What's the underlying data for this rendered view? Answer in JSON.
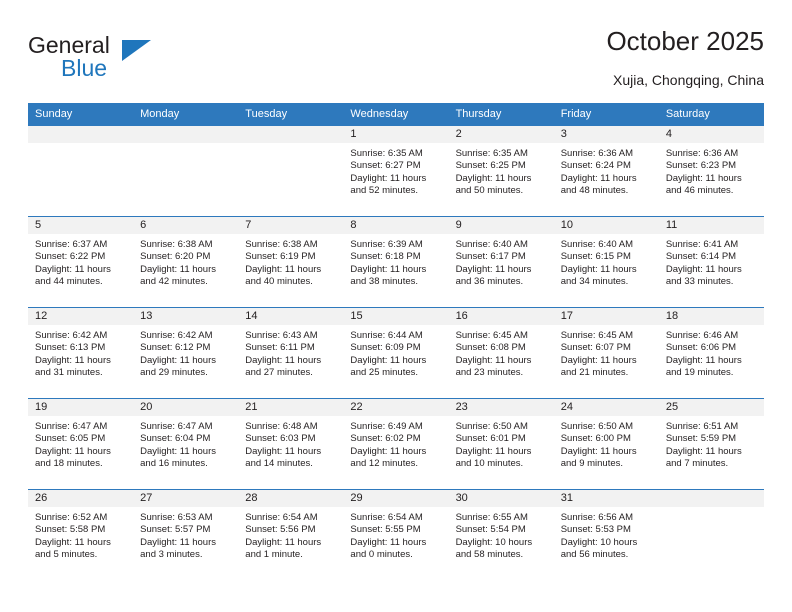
{
  "logo": {
    "word_top": "General",
    "word_bottom": "Blue",
    "accent_color": "#1f76bc"
  },
  "header": {
    "title": "October 2025",
    "location": "Xujia, Chongqing, China",
    "header_bg": "#2e79bd",
    "daynum_bg": "#f2f2f2"
  },
  "weekdays": [
    "Sunday",
    "Monday",
    "Tuesday",
    "Wednesday",
    "Thursday",
    "Friday",
    "Saturday"
  ],
  "weeks": [
    [
      {
        "day": "",
        "sunrise": "",
        "sunset": "",
        "daylight1": "",
        "daylight2": ""
      },
      {
        "day": "",
        "sunrise": "",
        "sunset": "",
        "daylight1": "",
        "daylight2": ""
      },
      {
        "day": "",
        "sunrise": "",
        "sunset": "",
        "daylight1": "",
        "daylight2": ""
      },
      {
        "day": "1",
        "sunrise": "Sunrise: 6:35 AM",
        "sunset": "Sunset: 6:27 PM",
        "daylight1": "Daylight: 11 hours",
        "daylight2": "and 52 minutes."
      },
      {
        "day": "2",
        "sunrise": "Sunrise: 6:35 AM",
        "sunset": "Sunset: 6:25 PM",
        "daylight1": "Daylight: 11 hours",
        "daylight2": "and 50 minutes."
      },
      {
        "day": "3",
        "sunrise": "Sunrise: 6:36 AM",
        "sunset": "Sunset: 6:24 PM",
        "daylight1": "Daylight: 11 hours",
        "daylight2": "and 48 minutes."
      },
      {
        "day": "4",
        "sunrise": "Sunrise: 6:36 AM",
        "sunset": "Sunset: 6:23 PM",
        "daylight1": "Daylight: 11 hours",
        "daylight2": "and 46 minutes."
      }
    ],
    [
      {
        "day": "5",
        "sunrise": "Sunrise: 6:37 AM",
        "sunset": "Sunset: 6:22 PM",
        "daylight1": "Daylight: 11 hours",
        "daylight2": "and 44 minutes."
      },
      {
        "day": "6",
        "sunrise": "Sunrise: 6:38 AM",
        "sunset": "Sunset: 6:20 PM",
        "daylight1": "Daylight: 11 hours",
        "daylight2": "and 42 minutes."
      },
      {
        "day": "7",
        "sunrise": "Sunrise: 6:38 AM",
        "sunset": "Sunset: 6:19 PM",
        "daylight1": "Daylight: 11 hours",
        "daylight2": "and 40 minutes."
      },
      {
        "day": "8",
        "sunrise": "Sunrise: 6:39 AM",
        "sunset": "Sunset: 6:18 PM",
        "daylight1": "Daylight: 11 hours",
        "daylight2": "and 38 minutes."
      },
      {
        "day": "9",
        "sunrise": "Sunrise: 6:40 AM",
        "sunset": "Sunset: 6:17 PM",
        "daylight1": "Daylight: 11 hours",
        "daylight2": "and 36 minutes."
      },
      {
        "day": "10",
        "sunrise": "Sunrise: 6:40 AM",
        "sunset": "Sunset: 6:15 PM",
        "daylight1": "Daylight: 11 hours",
        "daylight2": "and 34 minutes."
      },
      {
        "day": "11",
        "sunrise": "Sunrise: 6:41 AM",
        "sunset": "Sunset: 6:14 PM",
        "daylight1": "Daylight: 11 hours",
        "daylight2": "and 33 minutes."
      }
    ],
    [
      {
        "day": "12",
        "sunrise": "Sunrise: 6:42 AM",
        "sunset": "Sunset: 6:13 PM",
        "daylight1": "Daylight: 11 hours",
        "daylight2": "and 31 minutes."
      },
      {
        "day": "13",
        "sunrise": "Sunrise: 6:42 AM",
        "sunset": "Sunset: 6:12 PM",
        "daylight1": "Daylight: 11 hours",
        "daylight2": "and 29 minutes."
      },
      {
        "day": "14",
        "sunrise": "Sunrise: 6:43 AM",
        "sunset": "Sunset: 6:11 PM",
        "daylight1": "Daylight: 11 hours",
        "daylight2": "and 27 minutes."
      },
      {
        "day": "15",
        "sunrise": "Sunrise: 6:44 AM",
        "sunset": "Sunset: 6:09 PM",
        "daylight1": "Daylight: 11 hours",
        "daylight2": "and 25 minutes."
      },
      {
        "day": "16",
        "sunrise": "Sunrise: 6:45 AM",
        "sunset": "Sunset: 6:08 PM",
        "daylight1": "Daylight: 11 hours",
        "daylight2": "and 23 minutes."
      },
      {
        "day": "17",
        "sunrise": "Sunrise: 6:45 AM",
        "sunset": "Sunset: 6:07 PM",
        "daylight1": "Daylight: 11 hours",
        "daylight2": "and 21 minutes."
      },
      {
        "day": "18",
        "sunrise": "Sunrise: 6:46 AM",
        "sunset": "Sunset: 6:06 PM",
        "daylight1": "Daylight: 11 hours",
        "daylight2": "and 19 minutes."
      }
    ],
    [
      {
        "day": "19",
        "sunrise": "Sunrise: 6:47 AM",
        "sunset": "Sunset: 6:05 PM",
        "daylight1": "Daylight: 11 hours",
        "daylight2": "and 18 minutes."
      },
      {
        "day": "20",
        "sunrise": "Sunrise: 6:47 AM",
        "sunset": "Sunset: 6:04 PM",
        "daylight1": "Daylight: 11 hours",
        "daylight2": "and 16 minutes."
      },
      {
        "day": "21",
        "sunrise": "Sunrise: 6:48 AM",
        "sunset": "Sunset: 6:03 PM",
        "daylight1": "Daylight: 11 hours",
        "daylight2": "and 14 minutes."
      },
      {
        "day": "22",
        "sunrise": "Sunrise: 6:49 AM",
        "sunset": "Sunset: 6:02 PM",
        "daylight1": "Daylight: 11 hours",
        "daylight2": "and 12 minutes."
      },
      {
        "day": "23",
        "sunrise": "Sunrise: 6:50 AM",
        "sunset": "Sunset: 6:01 PM",
        "daylight1": "Daylight: 11 hours",
        "daylight2": "and 10 minutes."
      },
      {
        "day": "24",
        "sunrise": "Sunrise: 6:50 AM",
        "sunset": "Sunset: 6:00 PM",
        "daylight1": "Daylight: 11 hours",
        "daylight2": "and 9 minutes."
      },
      {
        "day": "25",
        "sunrise": "Sunrise: 6:51 AM",
        "sunset": "Sunset: 5:59 PM",
        "daylight1": "Daylight: 11 hours",
        "daylight2": "and 7 minutes."
      }
    ],
    [
      {
        "day": "26",
        "sunrise": "Sunrise: 6:52 AM",
        "sunset": "Sunset: 5:58 PM",
        "daylight1": "Daylight: 11 hours",
        "daylight2": "and 5 minutes."
      },
      {
        "day": "27",
        "sunrise": "Sunrise: 6:53 AM",
        "sunset": "Sunset: 5:57 PM",
        "daylight1": "Daylight: 11 hours",
        "daylight2": "and 3 minutes."
      },
      {
        "day": "28",
        "sunrise": "Sunrise: 6:54 AM",
        "sunset": "Sunset: 5:56 PM",
        "daylight1": "Daylight: 11 hours",
        "daylight2": "and 1 minute."
      },
      {
        "day": "29",
        "sunrise": "Sunrise: 6:54 AM",
        "sunset": "Sunset: 5:55 PM",
        "daylight1": "Daylight: 11 hours",
        "daylight2": "and 0 minutes."
      },
      {
        "day": "30",
        "sunrise": "Sunrise: 6:55 AM",
        "sunset": "Sunset: 5:54 PM",
        "daylight1": "Daylight: 10 hours",
        "daylight2": "and 58 minutes."
      },
      {
        "day": "31",
        "sunrise": "Sunrise: 6:56 AM",
        "sunset": "Sunset: 5:53 PM",
        "daylight1": "Daylight: 10 hours",
        "daylight2": "and 56 minutes."
      },
      {
        "day": "",
        "sunrise": "",
        "sunset": "",
        "daylight1": "",
        "daylight2": ""
      }
    ]
  ]
}
